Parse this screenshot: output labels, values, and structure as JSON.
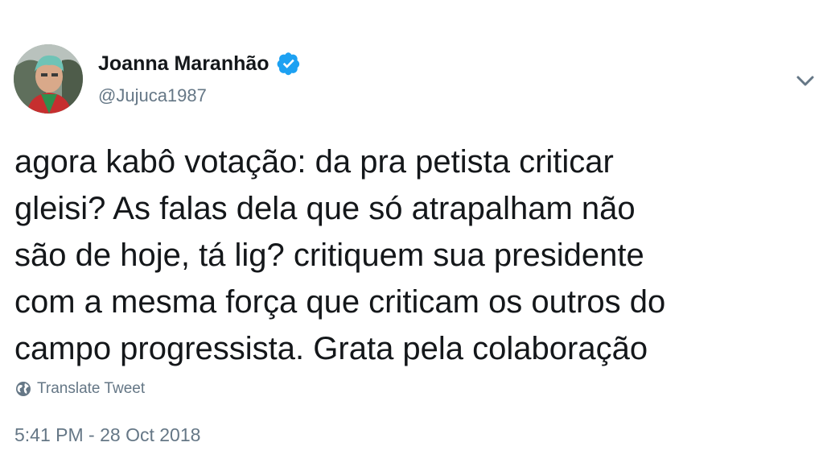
{
  "author": {
    "display_name": "Joanna Maranhão",
    "handle": "@Jujuca1987",
    "verified": true,
    "avatar_icon": "user-photo",
    "verified_icon": "verified-badge-icon",
    "verified_color": "#1da1f2"
  },
  "menu": {
    "icon": "chevron-down-icon"
  },
  "tweet": {
    "lines": [
      "agora kabô votação: da pra petista criticar",
      "gleisi? As falas dela que só atrapalham não",
      "são de hoje, tá lig? critiquem sua presidente",
      "com a mesma força que criticam os outros do",
      "campo progressista. Grata pela colaboração"
    ]
  },
  "translate": {
    "label": "Translate Tweet",
    "icon": "globe-icon"
  },
  "timestamp": "5:41 PM - 28 Oct 2018",
  "colors": {
    "text": "#14171a",
    "secondary": "#657786",
    "accent": "#1da1f2",
    "background": "#ffffff"
  }
}
